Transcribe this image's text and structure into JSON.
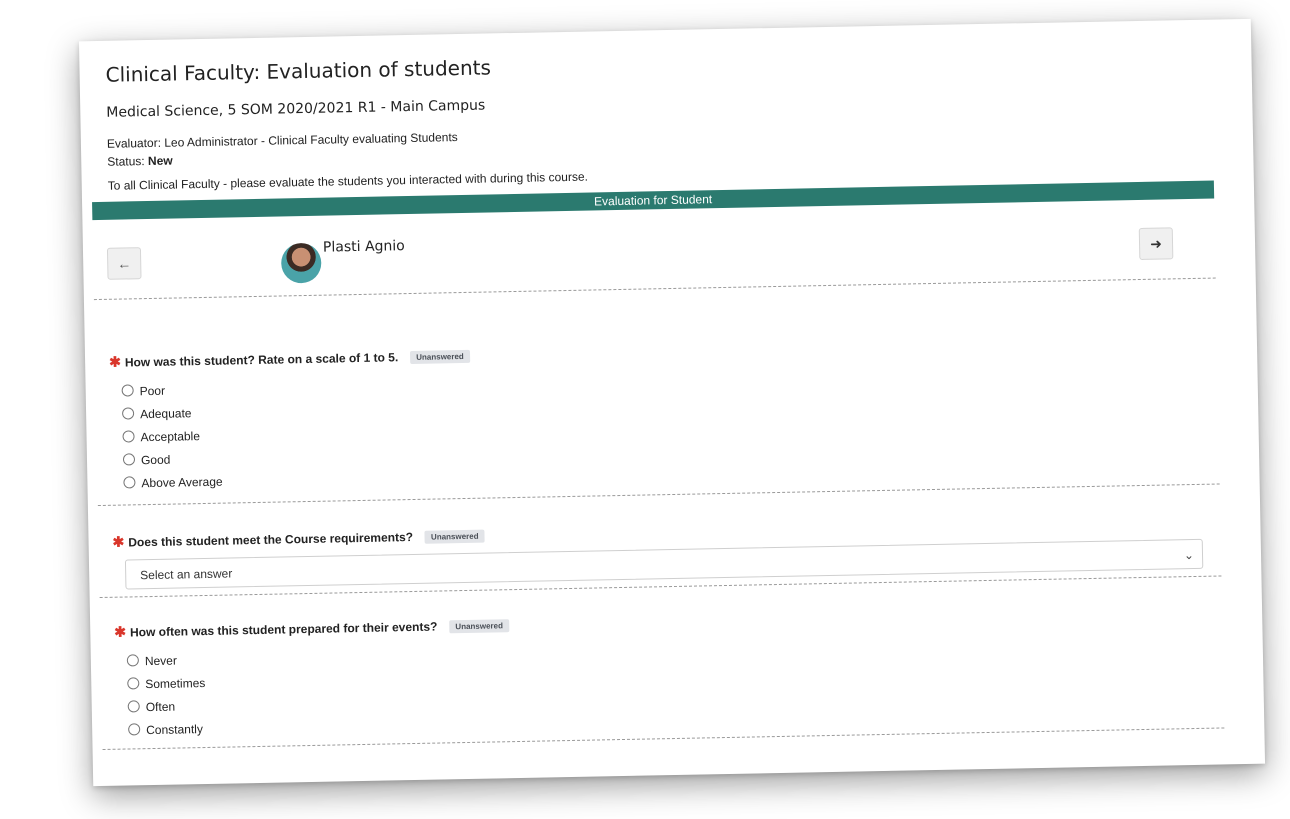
{
  "header": {
    "title": "Clinical Faculty: Evaluation of students",
    "subtitle": "Medical Science, 5 SOM 2020/2021 R1 - Main Campus",
    "evaluator": "Evaluator: Leo Administrator - Clinical Faculty evaluating Students",
    "status_label": "Status:",
    "status_value": "New",
    "instructions": "To all Clinical Faculty - please evaluate the students you interacted with during this course."
  },
  "band": {
    "label": "Evaluation for Student"
  },
  "student": {
    "name": "Plasti Agnio",
    "prev_icon": "arrow-left-icon",
    "next_icon": "arrow-right-icon"
  },
  "questions": [
    {
      "text": "How was this student?  Rate on a scale of 1 to 5.",
      "badge": "Unanswered",
      "type": "radio",
      "options": [
        "Poor",
        "Adequate",
        "Acceptable",
        "Good",
        "Above Average"
      ]
    },
    {
      "text": "Does this student meet the Course requirements?",
      "badge": "Unanswered",
      "type": "select",
      "placeholder": "Select an answer"
    },
    {
      "text": "How often was this student prepared for their events?",
      "badge": "Unanswered",
      "type": "radio",
      "options": [
        "Never",
        "Sometimes",
        "Often",
        "Constantly"
      ]
    }
  ],
  "colors": {
    "band": "#2b7a6f",
    "required": "#d9362b",
    "badge_bg": "#e2e4e8"
  }
}
